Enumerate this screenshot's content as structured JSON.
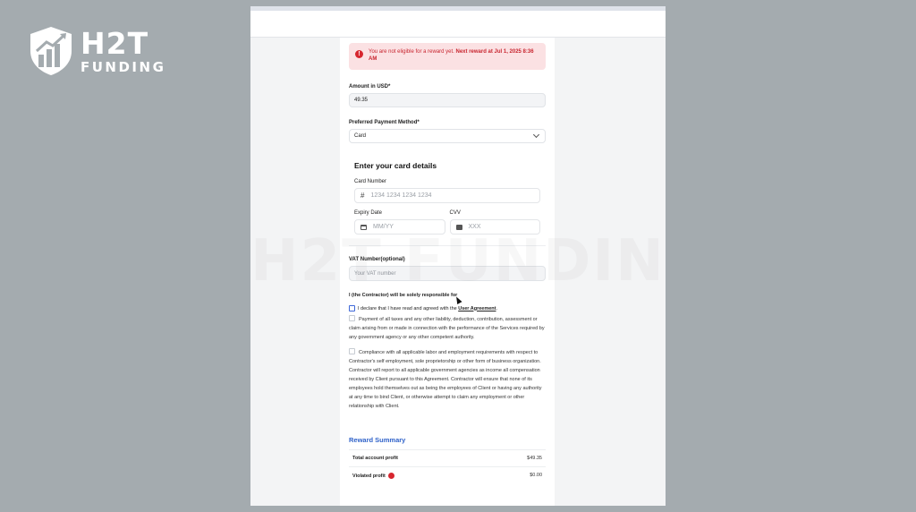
{
  "logo": {
    "main": "H2T",
    "sub": "FUNDING"
  },
  "alert": {
    "text": "You are not eligible for a reward yet. ",
    "strong": "Next reward at Jul 1, 2025 8:36 AM"
  },
  "amount": {
    "label": "Amount in USD*",
    "value": "49.35"
  },
  "payment_method": {
    "label": "Preferred Payment Method*",
    "selected": "Card"
  },
  "card": {
    "title": "Enter your card details",
    "number_label": "Card Number",
    "number_placeholder": "1234 1234 1234 1234",
    "expiry_label": "Expiry Date",
    "expiry_placeholder": "MM/YY",
    "cvv_label": "CVV",
    "cvv_placeholder": "XXX"
  },
  "vat": {
    "label": "VAT Number(optional)",
    "placeholder": "Your VAT number"
  },
  "responsibility": {
    "heading": "I (the Contractor) will be solely responsible for",
    "declare_text": "I declare that I have read and agreed with the ",
    "declare_link": "User Agreement",
    "declare_end": ".",
    "item1": "Payment of all taxes and any other liability, deduction, contribution, assessment or claim arising from or made in connection with the performance of the Services required by any government agency or any other competent authority.",
    "item2": "Compliance with all applicable labor and employment requirements with respect to Contractor's self employment, sole proprietorship or other form of business organization. Contractor will report to all applicable government agencies as income all compensation received by Client pursuant to this Agreement. Contractor will ensure that none of its employees hold themselves out as being the employees of Client or having any authority at any time to bind Client, or otherwise attempt to claim any employment or other relationship with Client."
  },
  "reward_summary": {
    "title": "Reward Summary",
    "rows": [
      {
        "label": "Total account profit",
        "value": "$49.35"
      },
      {
        "label": "Violated profit",
        "value": "$0.00"
      }
    ]
  },
  "watermark": "H2T FUNDING",
  "colors": {
    "alert_bg": "#fbe1e3",
    "alert_text": "#c8252f",
    "link_blue": "#2f62c9",
    "background": "#a4abaf"
  }
}
